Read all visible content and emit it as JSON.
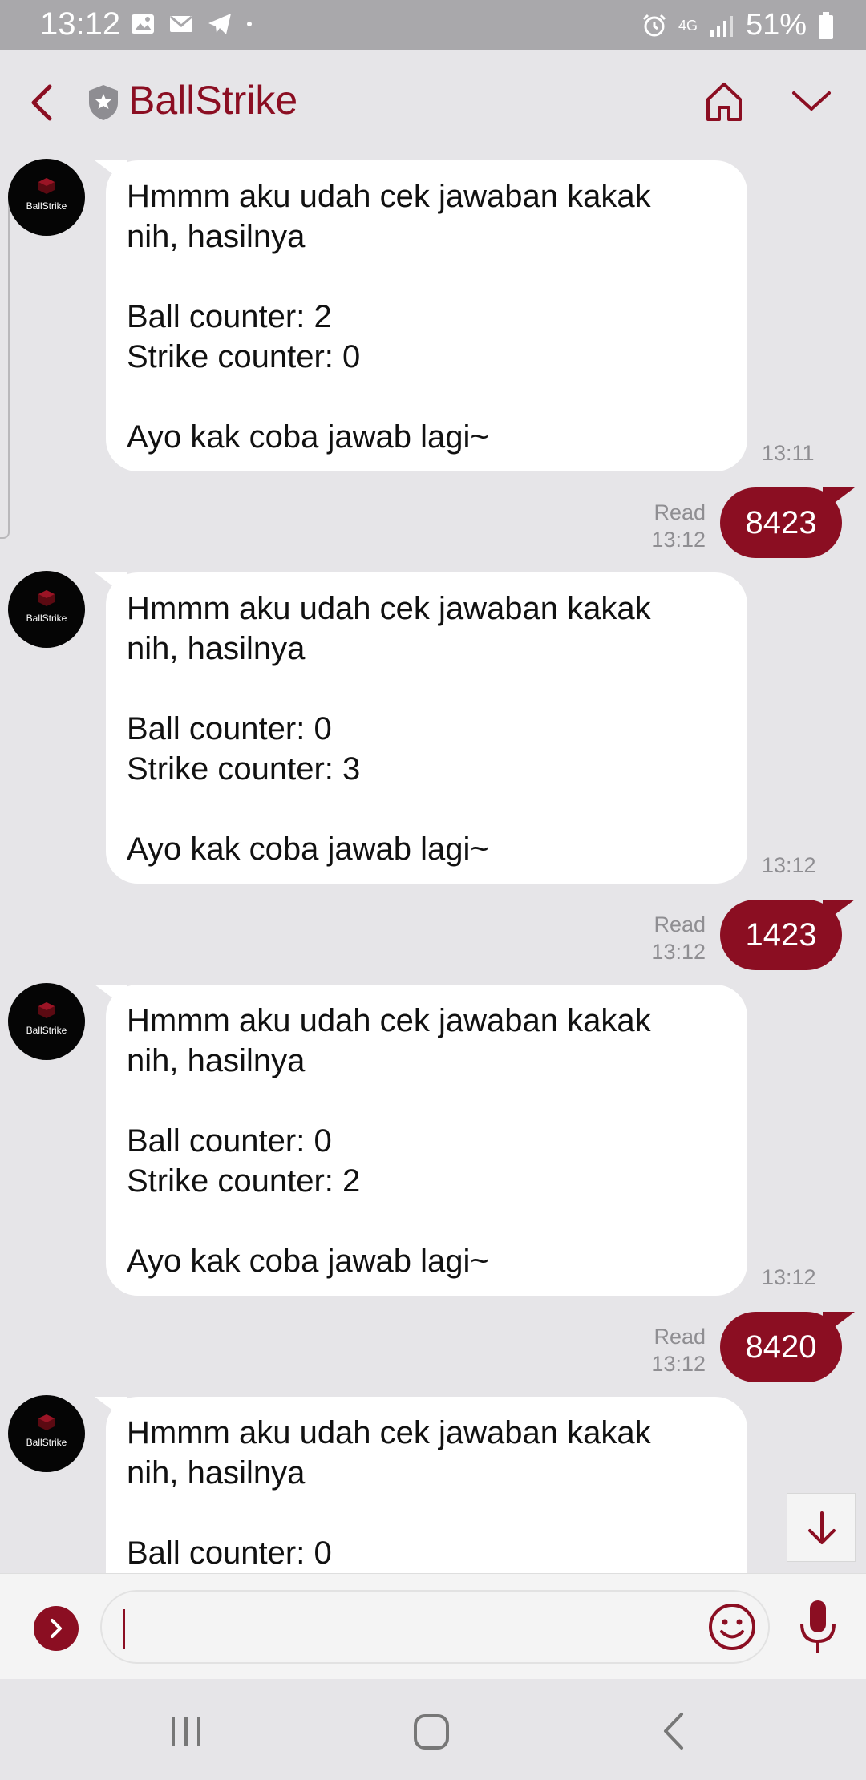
{
  "status_bar": {
    "time": "13:12",
    "network": "4G",
    "battery": "51%",
    "battery_level": "7"
  },
  "header": {
    "title": "BallStrike"
  },
  "messages": [
    {
      "from": "bot",
      "text": "Hmmm aku udah cek jawaban kakak\nnih, hasilnya\n\nBall counter: 2\nStrike counter: 0\n\nAyo kak coba jawab lagi~",
      "time": "13:11",
      "avatar_label": "BallStrike"
    },
    {
      "from": "me",
      "text": "8423",
      "status": "Read",
      "time": "13:12"
    },
    {
      "from": "bot",
      "text": "Hmmm aku udah cek jawaban kakak\nnih, hasilnya\n\nBall counter: 0\nStrike counter: 3\n\nAyo kak coba jawab lagi~",
      "time": "13:12",
      "avatar_label": "BallStrike"
    },
    {
      "from": "me",
      "text": "1423",
      "status": "Read",
      "time": "13:12"
    },
    {
      "from": "bot",
      "text": "Hmmm aku udah cek jawaban kakak\nnih, hasilnya\n\nBall counter: 0\nStrike counter: 2\n\nAyo kak coba jawab lagi~",
      "time": "13:12",
      "avatar_label": "BallStrike"
    },
    {
      "from": "me",
      "text": "8420",
      "status": "Read",
      "time": "13:12"
    },
    {
      "from": "bot",
      "text": "Hmmm aku udah cek jawaban kakak\nnih, hasilnya\n\nBall counter: 0",
      "avatar_label": "BallStrike"
    }
  ],
  "input": {
    "value": "",
    "placeholder": ""
  },
  "colors": {
    "accent": "#8b0e22",
    "background": "#e6e5e8",
    "status_bar": "#a9a8ab"
  }
}
